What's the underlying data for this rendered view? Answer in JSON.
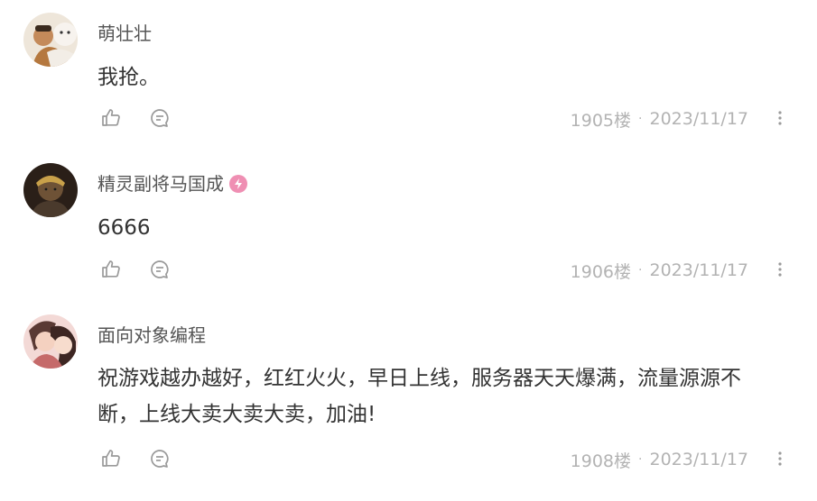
{
  "comments": [
    {
      "username": "萌壮壮",
      "content": "我抢。",
      "floor": "1905楼",
      "separator": "·",
      "date": "2023/11/17"
    },
    {
      "username": "精灵副将马国成",
      "content": "6666",
      "floor": "1906楼",
      "separator": "·",
      "date": "2023/11/17",
      "badge_icon": "user-level-badge-icon"
    },
    {
      "username": "面向对象编程",
      "content": "祝游戏越办越好，红红火火，早日上线，服务器天天爆满，流量源源不断，上线大卖大卖大卖，加油!",
      "floor": "1908楼",
      "separator": "·",
      "date": "2023/11/17"
    }
  ],
  "icons": {
    "like": "thumbs-up-icon",
    "reply": "comment-bubble-icon",
    "more": "more-vertical-icon"
  },
  "colors": {
    "meta_text": "#b3b3b3",
    "icon": "#9a9a9a",
    "badge": "#ef8fb3"
  }
}
